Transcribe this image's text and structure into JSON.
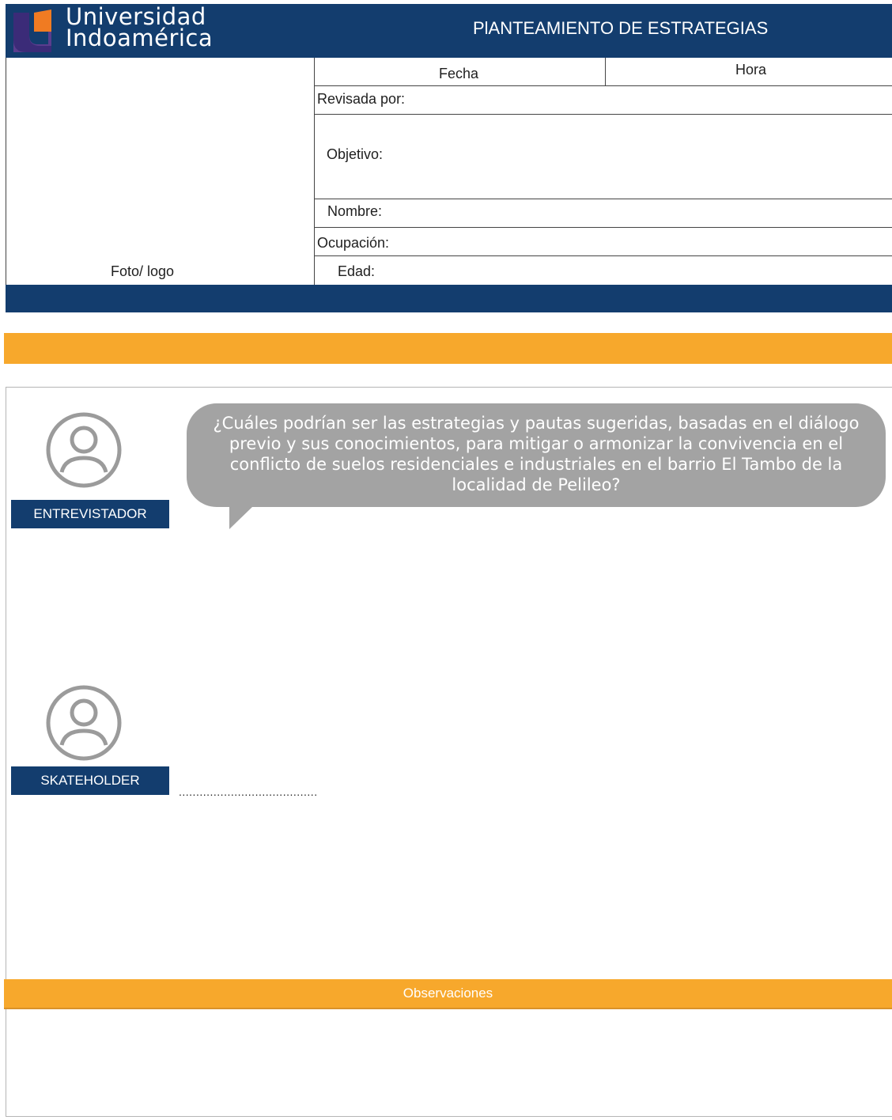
{
  "header": {
    "logo_line1": "Universidad",
    "logo_line2": "Indoamérica",
    "title": "PlANTEAMIENTO DE ESTRATEGIAS",
    "colors": {
      "navy": "#133d6e",
      "orange": "#f7a82c",
      "purple": "#5a3d8e"
    }
  },
  "info": {
    "photo_label": "Foto/ logo",
    "fecha_label": "Fecha",
    "hora_label": "Hora",
    "revisada_label": "Revisada por:",
    "objetivo_label": "Objetivo:",
    "nombre_label": "Nombre:",
    "ocupacion_label": "Ocupación:",
    "edad_label": "Edad:"
  },
  "interview": {
    "interviewer": {
      "role": "ENTREVISTADOR",
      "icon": "user-circle-icon"
    },
    "question": "¿Cuáles podrían ser las estrategias y pautas sugeridas, basadas en el diálogo previo y sus conocimientos, para mitigar o armonizar la convivencia en el conflicto de suelos residenciales e industriales en el barrio El Tambo de la localidad de Pelileo?",
    "stakeholder": {
      "role": "SKATEHOLDER",
      "icon": "user-circle-icon"
    },
    "answer_placeholder": "........................................"
  },
  "observations": {
    "title": "Observaciones"
  }
}
